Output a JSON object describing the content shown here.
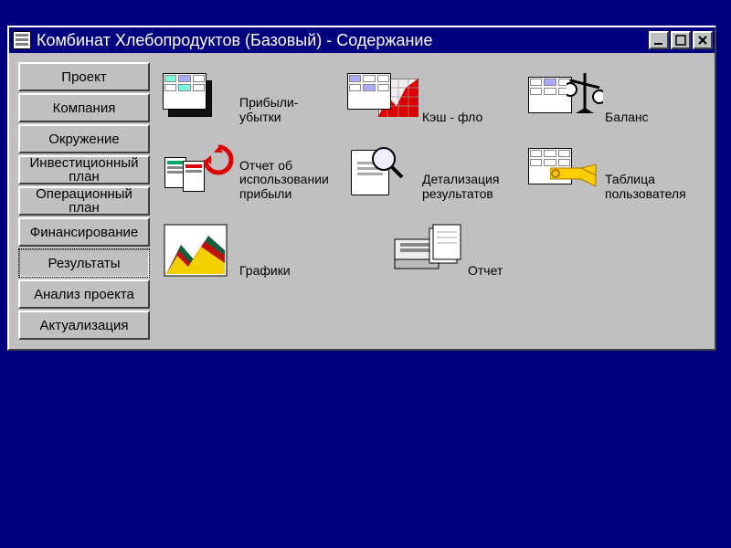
{
  "window": {
    "title": "Комбинат Хлебопродуктов (Базовый) - Содержание"
  },
  "sidebar": {
    "items": [
      {
        "label": "Проект"
      },
      {
        "label": "Компания"
      },
      {
        "label": "Окружение"
      },
      {
        "label": "Инвестиционный план"
      },
      {
        "label": "Операционный план"
      },
      {
        "label": "Финансирование"
      },
      {
        "label": "Результаты"
      },
      {
        "label": "Анализ проекта"
      },
      {
        "label": "Актуализация"
      }
    ]
  },
  "content": {
    "items": [
      {
        "label": "Прибыли-\nубытки"
      },
      {
        "label": "Кэш - фло"
      },
      {
        "label": "Баланс"
      },
      {
        "label": "Отчет об\nиспользовании\nприбыли"
      },
      {
        "label": "Детализация\nрезультатов"
      },
      {
        "label": "Таблица\nпользователя"
      },
      {
        "label": "Графики"
      },
      {
        "label": "Отчет"
      }
    ]
  }
}
